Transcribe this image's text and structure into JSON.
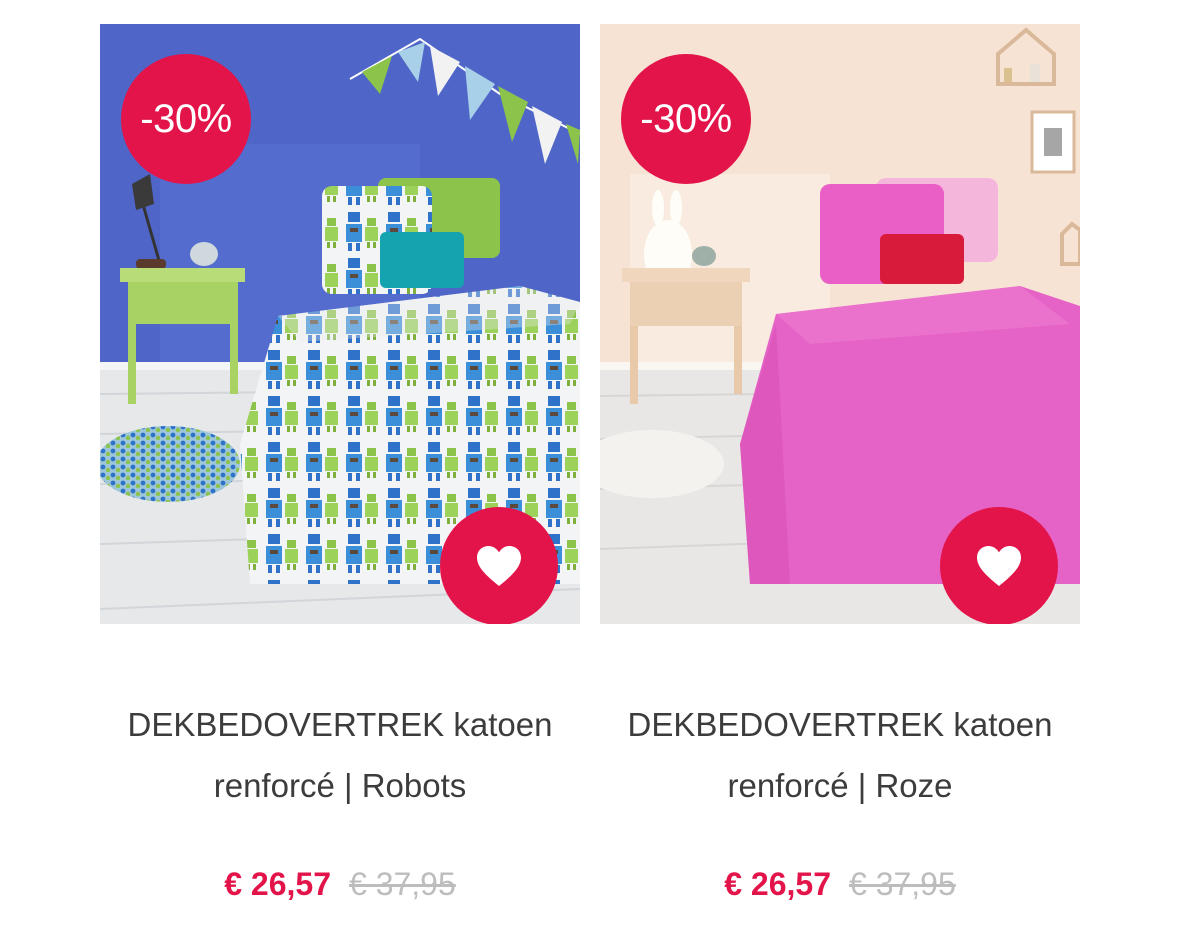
{
  "colors": {
    "accent": "#e3144a",
    "title_text": "#3c3c3c",
    "old_price": "#bdbdbd"
  },
  "products": [
    {
      "badge": "-30%",
      "title_line1": "DEKBEDOVERTREK katoen",
      "title_line2": "renforcé | Robots",
      "price": "€ 26,57",
      "old_price": "€ 37,95",
      "wishlist_icon": "heart-icon",
      "image": "robots-bedding-photo"
    },
    {
      "badge": "-30%",
      "title_line1": "DEKBEDOVERTREK katoen",
      "title_line2": "renforcé | Roze",
      "price": "€ 26,57",
      "old_price": "€ 37,95",
      "wishlist_icon": "heart-icon",
      "image": "pink-bedding-photo"
    }
  ]
}
